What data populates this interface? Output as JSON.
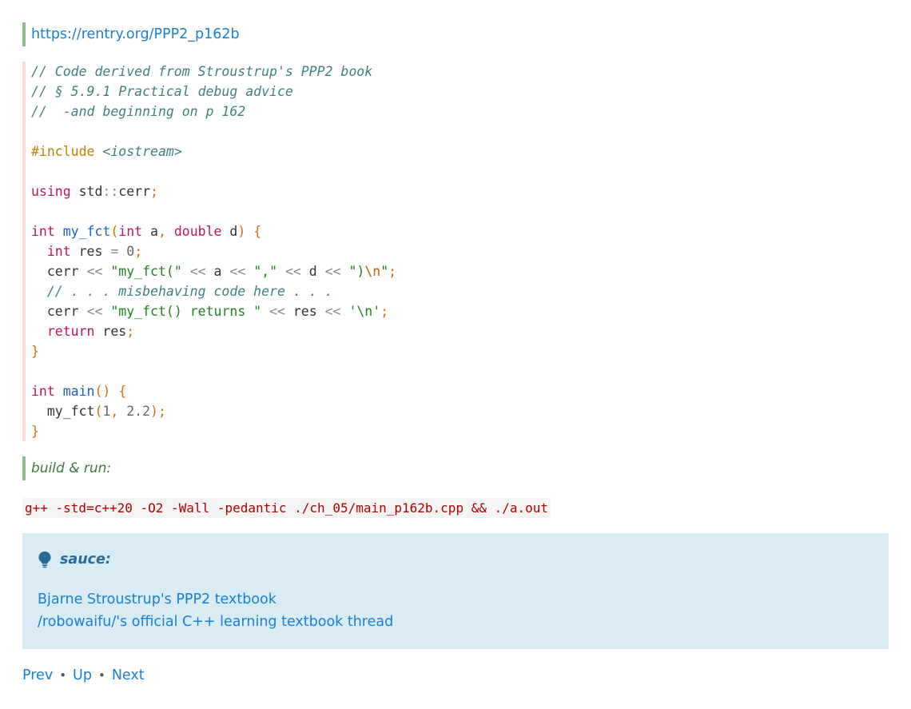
{
  "header_link": {
    "text": "https://rentry.org/PPP2_p162b"
  },
  "code": {
    "l1": "// Code derived from Stroustrup's PPP2 book",
    "l2": "// § 5.9.1 Practical debug advice",
    "l3": "//  -and beginning on p 162",
    "include_kw": "#include",
    "include_file": "<iostream>",
    "using_kw": "using",
    "using_std": "std",
    "using_scope": "::",
    "using_name": "cerr",
    "semicolon": ";",
    "type_int": "int",
    "type_double": "double",
    "fn_name": "my_fct",
    "param_a": "a",
    "param_d": "d",
    "var_res": "res",
    "zero": "0",
    "cerr": "cerr",
    "op_out": "<<",
    "str_open": "\"my_fct(\"",
    "str_comma": "\",\"",
    "str_close": "\")",
    "esc_n": "\\n",
    "quote": "\"",
    "comment_body": "// . . . misbehaving code here . . .",
    "str_returns": "\"my_fct() returns \"",
    "char_nl": "'\\n'",
    "return_kw": "return",
    "main_name": "main",
    "call_one": "1",
    "call_two": "2.2"
  },
  "build_label": "build & run:",
  "command": "g++ -std=c++20 -O2 -Wall -pedantic ./ch_05/main_p162b.cpp && ./a.out",
  "sauce": {
    "title": "sauce:",
    "icon": "lightbulb-icon",
    "links": [
      "Bjarne Stroustrup's PPP2 textbook",
      "/robowaifu/'s official C++ learning textbook thread"
    ]
  },
  "nav": {
    "prev": "Prev",
    "up": "Up",
    "next": "Next",
    "sep": "•"
  }
}
